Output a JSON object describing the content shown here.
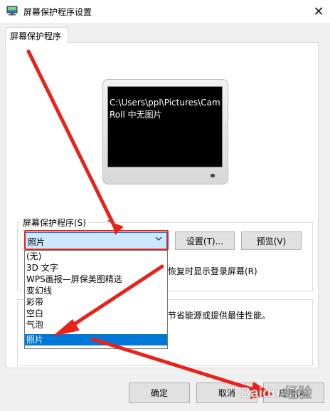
{
  "window": {
    "title": "屏幕保护程序设置",
    "close_glyph": "✕"
  },
  "tab": {
    "label": "屏幕保护程序"
  },
  "preview": {
    "line1": "C:\\Users\\ppl\\Pictures\\Cam",
    "line2": "Roll 中无图片"
  },
  "screensaver": {
    "group_label": "屏幕保护程序(S)",
    "selected": "照片",
    "settings_label": "设置(T)...",
    "preview_label": "预览(V)",
    "behind_resume_text": "恢复时显示登录屏幕(R)",
    "behind_power_text": "节省能源或提供最佳性能。",
    "options": [
      "(无)",
      "3D 文字",
      "WPS画报—屏保美图精选",
      "变幻线",
      "彩带",
      "空白",
      "气泡",
      "照片"
    ],
    "selected_index": 7
  },
  "footer": {
    "ok_label": "确定",
    "cancel_label": "取消",
    "apply_label": "应用(A)"
  },
  "colors": {
    "accent": "#0078d7",
    "annotation_red": "#e8221b",
    "selection_bg": "#cce8ff"
  },
  "icons": {
    "app": "monitor-icon",
    "close": "close-icon",
    "chevron": "chevron-down-icon"
  },
  "watermark": {
    "text": "Baidu 经验"
  }
}
